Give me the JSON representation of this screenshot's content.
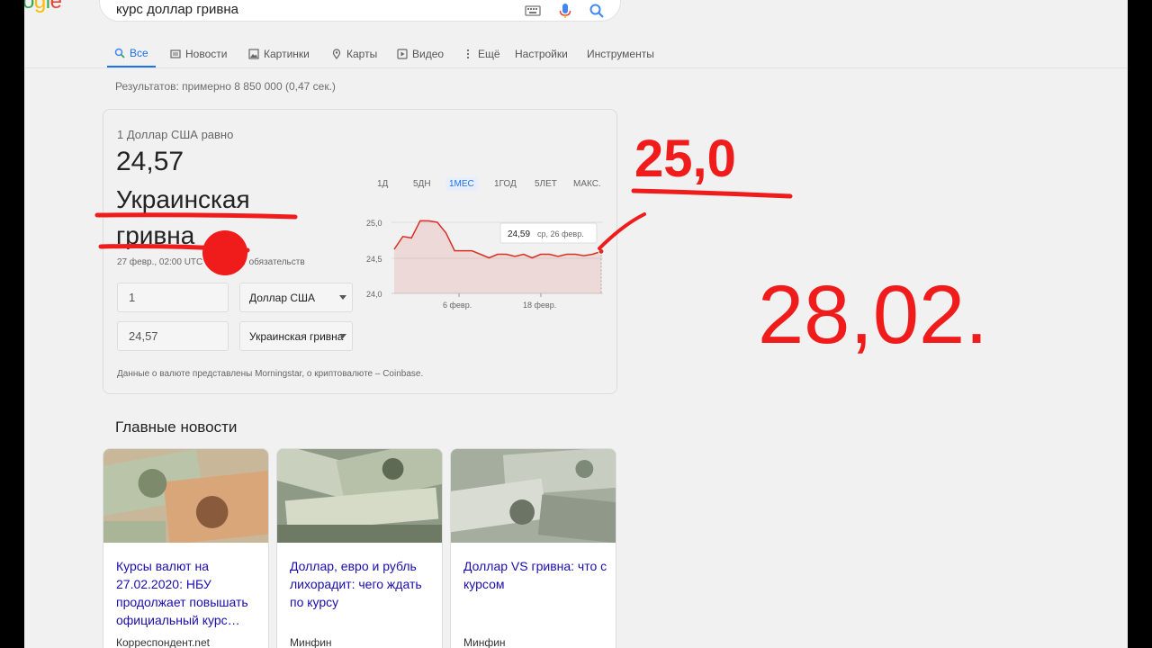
{
  "search": {
    "query": "курс доллар гривна"
  },
  "tabs": [
    {
      "label": "Все",
      "icon": "search-icon"
    },
    {
      "label": "Новости",
      "icon": "news-icon"
    },
    {
      "label": "Картинки",
      "icon": "image-icon"
    },
    {
      "label": "Карты",
      "icon": "map-pin-icon"
    },
    {
      "label": "Видео",
      "icon": "video-icon"
    },
    {
      "label": "Ещё",
      "icon": "more-icon"
    },
    {
      "label": "Настройки"
    },
    {
      "label": "Инструменты"
    }
  ],
  "results_count": "Результатов: примерно 8 850 000 (0,47 сек.)",
  "converter": {
    "equals_label": "1 Доллар США равно",
    "rate": "24,57",
    "currency": "Украинская гривна",
    "date": "27 февр., 02:00 UTC · Отказ от обязательств",
    "amount_from": "1",
    "currency_from": "Доллар США",
    "amount_to": "24,57",
    "currency_to": "Украинская гривна",
    "source": "Данные о валюте представлены Morningstar, о криптовалюте – Coinbase."
  },
  "ranges": [
    "1Д",
    "5ДН",
    "1МЕС",
    "1ГОД",
    "5ЛЕТ",
    "МАКС."
  ],
  "chart_data": {
    "type": "area",
    "x_tick_labels": [
      "6 февр.",
      "18 февр."
    ],
    "y_ticks": [
      "25,0",
      "24,5",
      "24,0"
    ],
    "ylim": [
      24.0,
      25.0
    ],
    "values": [
      24.62,
      24.8,
      24.78,
      25.02,
      25.02,
      25.0,
      24.85,
      24.6,
      24.6,
      24.6,
      24.55,
      24.5,
      24.55,
      24.55,
      24.52,
      24.55,
      24.5,
      24.55,
      24.55,
      24.52,
      24.55,
      24.55,
      24.53,
      24.55,
      24.59
    ],
    "tooltip": {
      "value": "24,59",
      "date": "ср, 26 февр."
    },
    "color": "#d93025"
  },
  "news_section_title": "Главные новости",
  "news": [
    {
      "title": "Курсы валют на 27.02.2020: НБУ продолжает повышать официальный курс…",
      "source": "Корреспондент.net"
    },
    {
      "title": "Доллар, евро и рубль лихорадит: чего ждать по курсу",
      "source": "Минфин"
    },
    {
      "title": "Доллар VS гривна: что с курсом",
      "source": "Минфин"
    }
  ],
  "annotations": {
    "upper_value": "25,0",
    "lower_value": "28,02."
  }
}
